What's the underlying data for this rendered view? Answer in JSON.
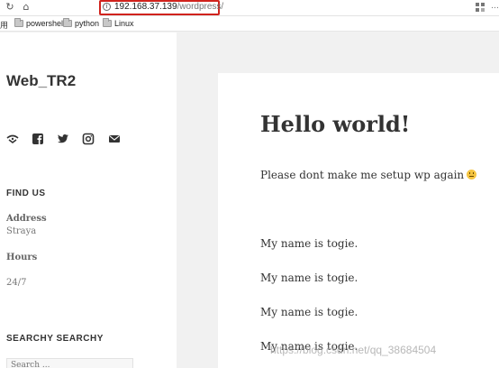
{
  "browser": {
    "url_host": "192.168.37.139",
    "url_path": "/wordpress/",
    "bookmarks_lead": "用",
    "bookmarks": [
      {
        "label": "powershell"
      },
      {
        "label": "python"
      },
      {
        "label": "Linux"
      }
    ]
  },
  "sidebar": {
    "site_title": "Web_TR2",
    "social_icons": [
      "wordpress-icon",
      "facebook-icon",
      "twitter-icon",
      "instagram-icon",
      "email-icon"
    ],
    "find_us": {
      "title": "FIND US",
      "address_label": "Address",
      "address_value": "Straya",
      "hours_label": "Hours",
      "hours_value": "24/7"
    },
    "search": {
      "title": "SEARCHY SEARCHY",
      "placeholder": "Search ..."
    }
  },
  "post": {
    "title": "Hello world!",
    "lead": "Please dont make me setup wp again",
    "lines": [
      "My name is togie.",
      "My name is togie.",
      "My name is togie.",
      "My name is togie."
    ]
  },
  "watermark": "https://blog.csdn.net/qq_38684504"
}
